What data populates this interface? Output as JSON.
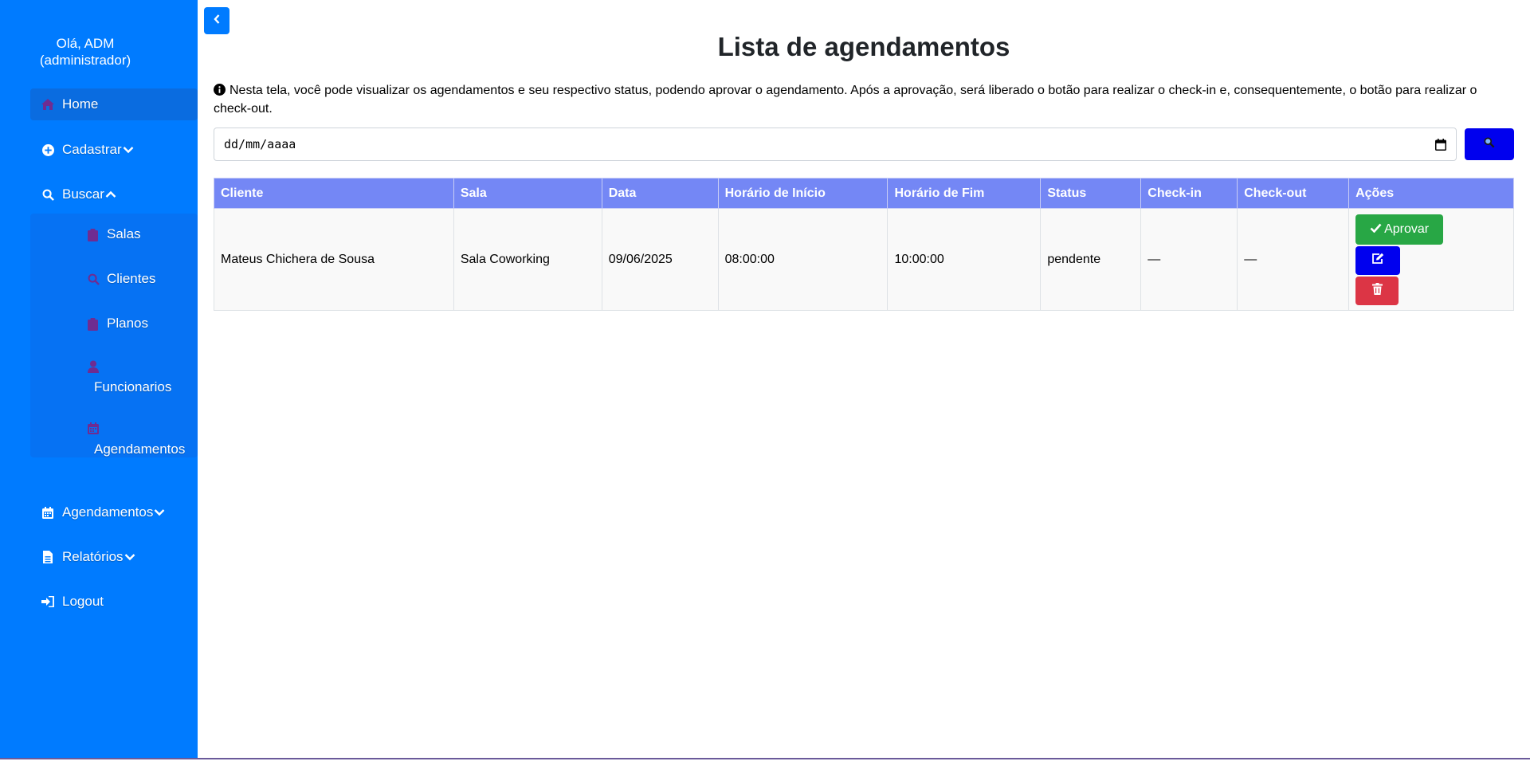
{
  "sidebar": {
    "greeting": "Olá, ADM (administrador)",
    "items": [
      {
        "label": "Home",
        "icon": "home-icon"
      },
      {
        "label": "Cadastrar",
        "icon": "plus-circle-icon"
      },
      {
        "label": "Buscar",
        "icon": "search-icon"
      },
      {
        "label": "Agendamentos",
        "icon": "calendar-icon"
      },
      {
        "label": "Relatórios",
        "icon": "file-icon"
      },
      {
        "label": "Logout",
        "icon": "sign-out-icon"
      }
    ],
    "search_submenu": [
      {
        "label": "Salas",
        "icon": "clipboard-icon"
      },
      {
        "label": "Clientes",
        "icon": "search-icon"
      },
      {
        "label": "Planos",
        "icon": "clipboard-icon"
      },
      {
        "label": "Funcionarios",
        "icon": "user-icon"
      },
      {
        "label": "Agendamentos",
        "icon": "calendar-icon"
      }
    ],
    "colors": {
      "background": "#007bff",
      "submenu_icon": "#6f2c91"
    }
  },
  "main": {
    "title": "Lista de agendamentos",
    "info": "Nesta tela, você pode visualizar os agendamentos e seu respectivo status, podendo aprovar o agendamento. Após a aprovação, será liberado o botão para realizar o check-in e, consequentemente, o botão para realizar o check-out.",
    "date_input": {
      "placeholder": "dd/mm/aaaa"
    },
    "table": {
      "headers": [
        "Cliente",
        "Sala",
        "Data",
        "Horário de Início",
        "Horário de Fim",
        "Status",
        "Check-in",
        "Check-out",
        "Ações"
      ],
      "rows": [
        {
          "cliente": "Mateus Chichera de Sousa",
          "sala": "Sala Coworking",
          "data": "09/06/2025",
          "inicio": "08:00:00",
          "fim": "10:00:00",
          "status": "pendente",
          "checkin": "—",
          "checkout": "—",
          "approve_label": "Aprovar"
        }
      ]
    },
    "colors": {
      "header": "#7487f5",
      "approve": "#28a745",
      "edit": "#0000ee",
      "delete": "#dc3545"
    }
  }
}
